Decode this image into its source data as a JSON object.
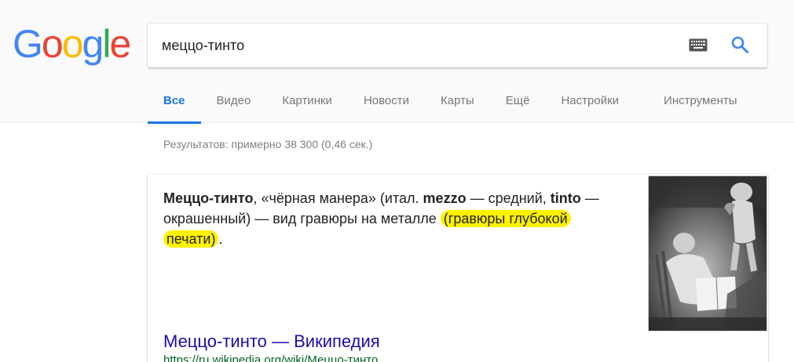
{
  "logo": {
    "letters": [
      "G",
      "o",
      "o",
      "g",
      "l",
      "e"
    ],
    "colors": [
      "#4285f4",
      "#ea4335",
      "#fbbc05",
      "#4285f4",
      "#34a853",
      "#ea4335"
    ]
  },
  "search": {
    "query": "меццо-тинто",
    "keyboard_icon": "keyboard-icon",
    "search_icon": "magnifier-icon",
    "accent": "#4285f4"
  },
  "tabs": [
    {
      "label": "Все",
      "active": true
    },
    {
      "label": "Видео",
      "active": false
    },
    {
      "label": "Картинки",
      "active": false
    },
    {
      "label": "Новости",
      "active": false
    },
    {
      "label": "Карты",
      "active": false
    },
    {
      "label": "Ещё",
      "active": false
    },
    {
      "label": "Настройки",
      "active": false
    },
    {
      "label": "Инструменты",
      "active": false
    }
  ],
  "stats": "Результатов: примерно 38 300 (0,46 сек.)",
  "featured": {
    "term": "Меццо-тинто",
    "part1": ", «чёрная манера» (итал. ",
    "mezzo": "mezzo",
    "part2": " — средний, ",
    "tinto": "tinto",
    "part3": " — окрашенный) — вид гравюры на металле ",
    "highlight": "(гравюры глубокой печати)",
    "part4": ".",
    "highlight_color": "#fff200",
    "result_title": "Меццо-тинто — Википедия",
    "result_url": "https://ru.wikipedia.org/wiki/Меццо-тинто",
    "link_color": "#1a0dab",
    "url_color": "#006621"
  }
}
